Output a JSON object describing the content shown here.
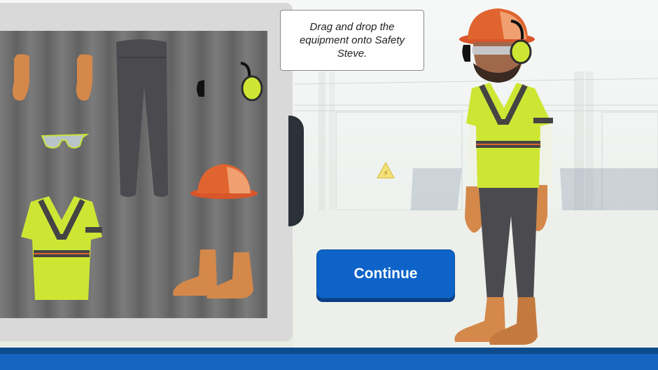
{
  "instruction": "Drag and drop the equipment onto Safety Steve.",
  "continue_button": {
    "label": "Continue"
  },
  "character": {
    "name": "Safety Steve"
  },
  "equipment": [
    "gloves",
    "pants",
    "earmuffs",
    "safety-glasses",
    "hard-hat",
    "safety-vest",
    "work-boots"
  ],
  "colors": {
    "button": "#0d63c8",
    "vest": "#cde634",
    "hat": "#e0642f",
    "footer": "#1565c0"
  }
}
